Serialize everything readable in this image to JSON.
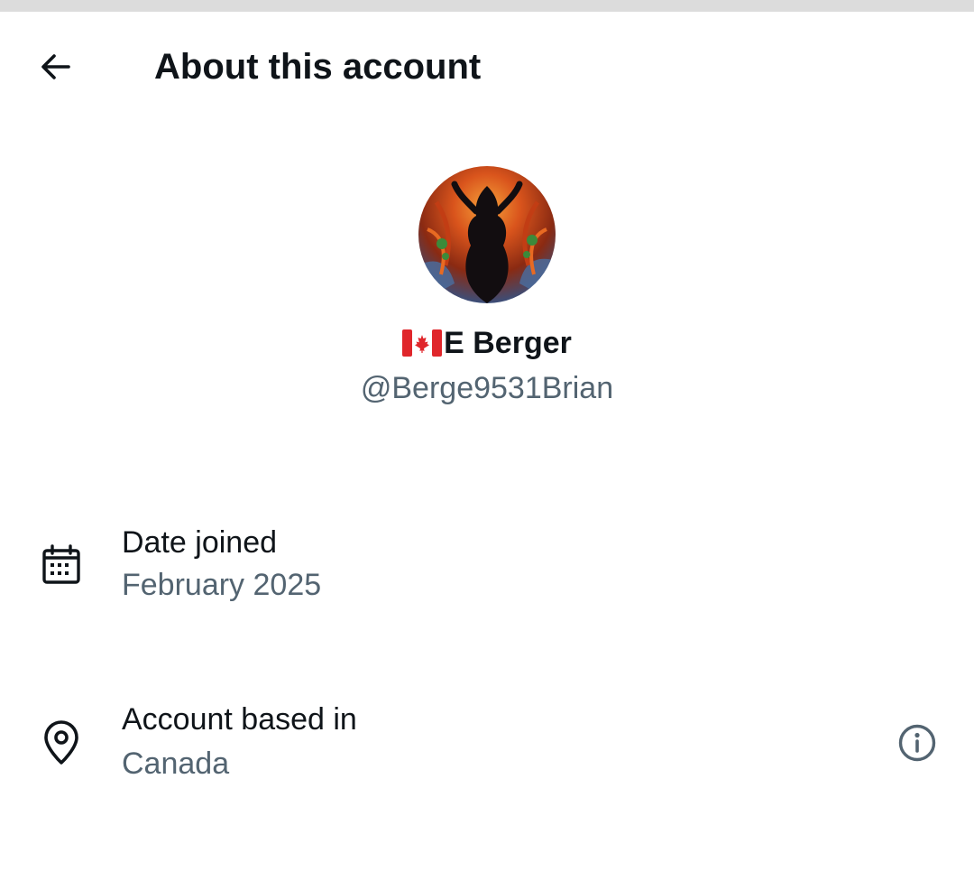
{
  "header": {
    "title": "About this account",
    "back_icon": "arrow-left-icon"
  },
  "profile": {
    "flag_icon": "canada-flag-icon",
    "display_name": "E Berger",
    "handle": "@Berge9531Brian",
    "avatar_icon": "profile-avatar"
  },
  "details": [
    {
      "icon": "calendar-icon",
      "label": "Date joined",
      "value": "February 2025"
    },
    {
      "icon": "location-pin-icon",
      "label": "Account based in",
      "value": "Canada",
      "action_icon": "info-icon"
    }
  ],
  "colors": {
    "primary_text": "#0f1419",
    "secondary_text": "#536471",
    "background": "#ffffff",
    "status_strip": "#dcdcdc"
  }
}
